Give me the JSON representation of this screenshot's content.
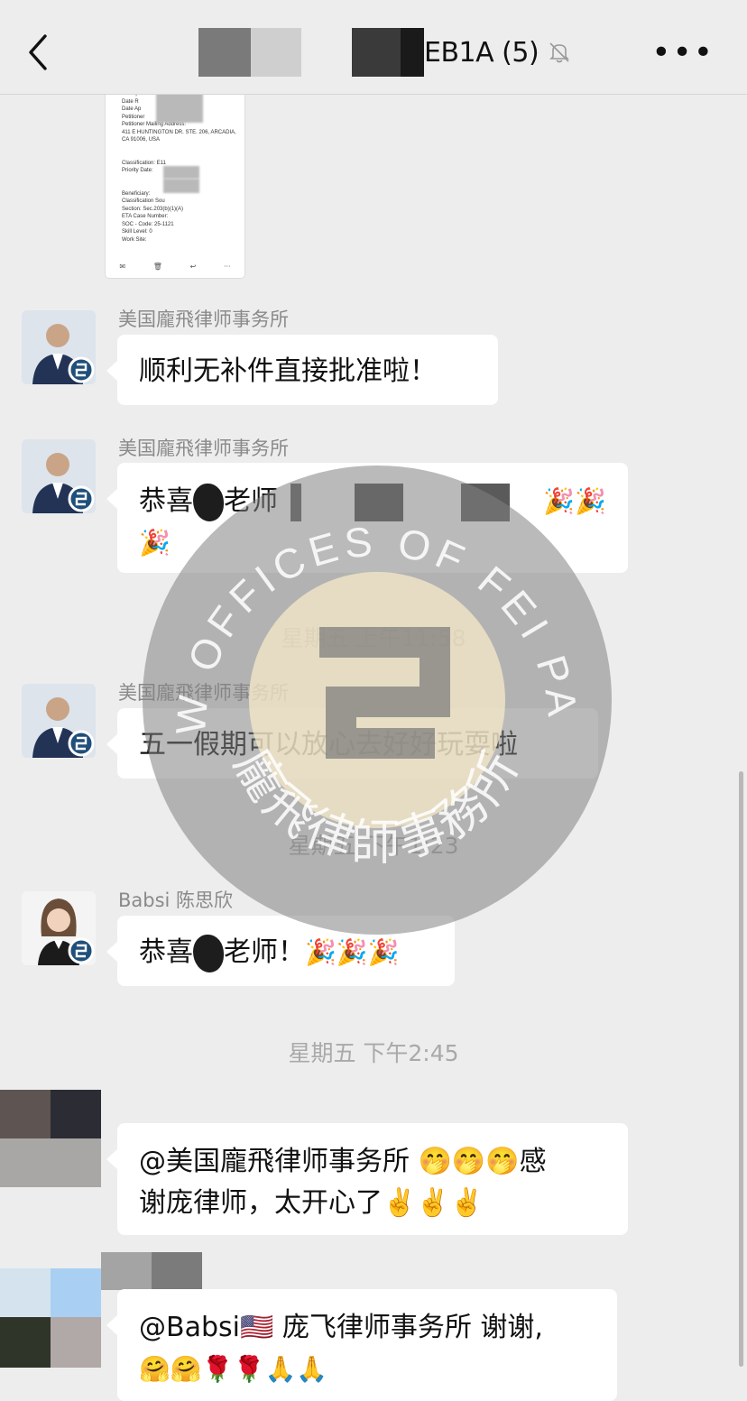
{
  "header": {
    "title": "EB1A (5)",
    "back_icon": "chevron-left-icon",
    "mute_icon": "bell-off-icon",
    "more_icon": "more-horizontal-icon"
  },
  "document_image": {
    "lines": "Receipt\nDate R\nDate Ap\nPetitioner\nPetitioner Mailing Address:\n411 E HUNTINGTON DR. STE. 206, ARCADIA,\nCA 91006, USA\n\n\nClassification: E11\nPriority Date:\n\n\nBeneficiary:\nClassification Sou\nSection: Sec.203(b)(1)(A)\nETA Case Number:\nSOC - Code: 25-1121\nSkill Level: 0\nWork Site:"
  },
  "messages": [
    {
      "sender": "美国龐飛律师事务所",
      "text": "顺利无补件直接批准啦！"
    },
    {
      "sender": "美国龐飛律师事务所",
      "pre": "恭喜",
      "post": "老师",
      "emoji_tail": "🎉🎉",
      "emoji_line2": "🎉"
    },
    {
      "time": "星期五 上午11:58"
    },
    {
      "sender": "美国龐飛律师事务所",
      "text": "五一假期可以放心去好好玩耍啦"
    },
    {
      "time": "星期五 下午1:23"
    },
    {
      "sender": "Babsi 陈思欣",
      "pre": "恭喜",
      "post": "老师！",
      "emoji_tail": "🎉🎉🎉"
    },
    {
      "time": "星期五 下午2:45"
    },
    {
      "line1": "@美国龐飛律师事务所 🤭🤭🤭感",
      "line2": "谢庞律师，太开心了✌️✌️✌️"
    },
    {
      "line1": "@Babsi🇺🇸 庞飞律师事务所 谢谢,",
      "line2": "🤗🤗🌹🌹🙏🙏"
    }
  ],
  "watermark": {
    "top_text": "LAW OFFICES OF FEI PANG",
    "bottom_text": "龐飛律師事務所"
  },
  "colors": {
    "background": "#ededed",
    "bubble": "#ffffff",
    "time_text": "#a9a9a9",
    "sender_text": "#8a8a8a"
  }
}
